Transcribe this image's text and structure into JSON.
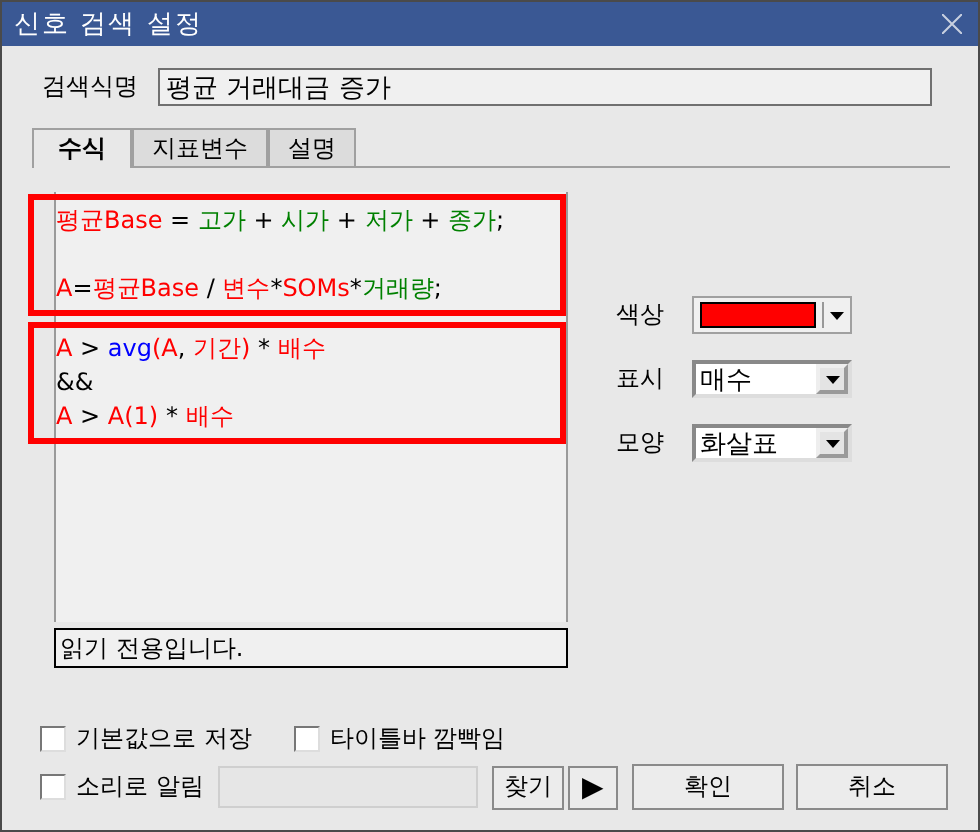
{
  "window": {
    "title": "신호 검색 설정"
  },
  "name_field": {
    "label": "검색식명",
    "value": "평균 거래대금 증가"
  },
  "tabs": [
    {
      "label": "수식",
      "selected": true
    },
    {
      "label": "지표변수",
      "selected": false
    },
    {
      "label": "설명",
      "selected": false
    }
  ],
  "editor": {
    "blocks": [
      {
        "highlighted": true,
        "lines": [
          {
            "kind": "code",
            "tokens": [
              {
                "kind": "var",
                "text": "평균Base"
              },
              {
                "kind": "op",
                "text": " = "
              },
              {
                "kind": "field",
                "text": "고가"
              },
              {
                "kind": "op",
                "text": " + "
              },
              {
                "kind": "field",
                "text": "시가"
              },
              {
                "kind": "op",
                "text": " + "
              },
              {
                "kind": "field",
                "text": "저가"
              },
              {
                "kind": "op",
                "text": " + "
              },
              {
                "kind": "field",
                "text": "종가"
              },
              {
                "kind": "op",
                "text": ";"
              }
            ]
          },
          {
            "kind": "blank"
          },
          {
            "kind": "code",
            "tokens": [
              {
                "kind": "var",
                "text": "A"
              },
              {
                "kind": "op",
                "text": "="
              },
              {
                "kind": "var",
                "text": "평균Base"
              },
              {
                "kind": "op",
                "text": " / "
              },
              {
                "kind": "var",
                "text": "변수"
              },
              {
                "kind": "op",
                "text": "*"
              },
              {
                "kind": "var",
                "text": "SOMs"
              },
              {
                "kind": "op",
                "text": "*"
              },
              {
                "kind": "field",
                "text": "거래량"
              },
              {
                "kind": "op",
                "text": ";"
              }
            ]
          }
        ]
      },
      {
        "highlighted": true,
        "lines": [
          {
            "kind": "code",
            "tokens": [
              {
                "kind": "var",
                "text": "A"
              },
              {
                "kind": "op",
                "text": " > "
              },
              {
                "kind": "func",
                "text": "avg"
              },
              {
                "kind": "var",
                "text": "(A"
              },
              {
                "kind": "op",
                "text": ", "
              },
              {
                "kind": "var",
                "text": "기간)"
              },
              {
                "kind": "op",
                "text": " * "
              },
              {
                "kind": "var",
                "text": "배수"
              }
            ]
          },
          {
            "kind": "code",
            "tokens": [
              {
                "kind": "op",
                "text": "&&"
              }
            ]
          },
          {
            "kind": "code",
            "tokens": [
              {
                "kind": "var",
                "text": "A"
              },
              {
                "kind": "op",
                "text": " > "
              },
              {
                "kind": "var",
                "text": "A(1)"
              },
              {
                "kind": "op",
                "text": " * "
              },
              {
                "kind": "var",
                "text": "배수"
              }
            ]
          }
        ]
      }
    ]
  },
  "status": "읽기 전용입니다.",
  "options": [
    {
      "kind": "color",
      "label": "색상",
      "color": "#ff0000"
    },
    {
      "kind": "select",
      "label": "표시",
      "value": "매수"
    },
    {
      "kind": "select",
      "label": "모양",
      "value": "화살표"
    }
  ],
  "checkboxes": [
    {
      "label": "기본값으로 저장",
      "checked": false
    },
    {
      "label": "타이틀바 깜빡임",
      "checked": false
    },
    {
      "label": "소리로 알림",
      "checked": false
    }
  ],
  "buttons": [
    {
      "kind": "find",
      "label": "찾기"
    },
    {
      "kind": "play",
      "label": "▶"
    },
    {
      "kind": "ok",
      "label": "확인"
    },
    {
      "kind": "cancel",
      "label": "취소"
    }
  ]
}
